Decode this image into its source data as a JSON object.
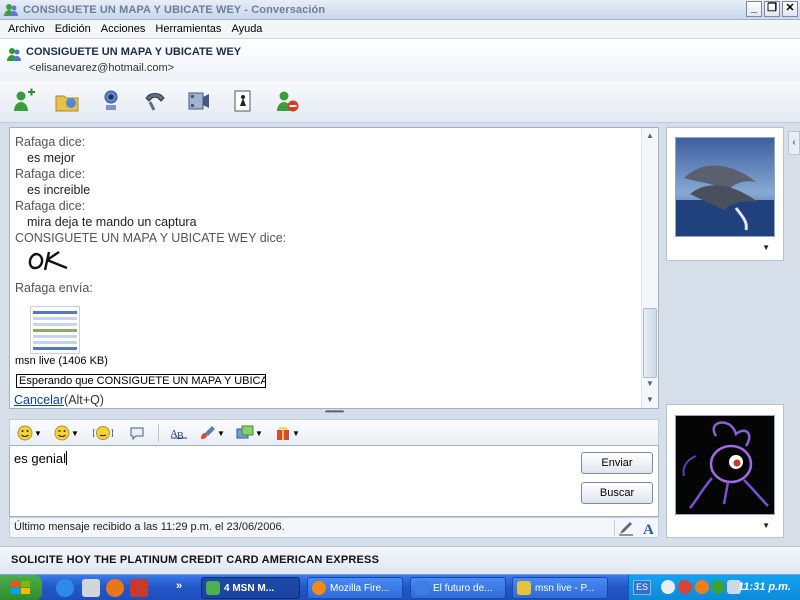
{
  "window": {
    "title": "CONSIGUETE UN MAPA Y UBICATE WEY - Conversación",
    "controls": [
      "_",
      "❐",
      "✕"
    ]
  },
  "menu": [
    "Archivo",
    "Edición",
    "Acciones",
    "Herramientas",
    "Ayuda"
  ],
  "contact": {
    "name": "CONSIGUETE UN MAPA Y UBICATE WEY",
    "email": "<elisanevarez@hotmail.com>"
  },
  "toolbar": {
    "icons": [
      "invite-contact-icon",
      "send-files-icon",
      "webcam-icon",
      "call-icon",
      "video-icon",
      "games-icon",
      "block-icon"
    ]
  },
  "chat": {
    "messages": [
      {
        "sender": "Rafaga dice:",
        "text": "es mejor"
      },
      {
        "sender": "Rafaga dice:",
        "text": "es increible"
      },
      {
        "sender": "Rafaga dice:",
        "text": "mira deja te mando un captura"
      }
    ],
    "contact_sender": "CONSIGUETE UN MAPA Y UBICATE WEY dice:",
    "contact_msg": "OK",
    "transfer_header": "Rafaga envía:",
    "file_label": "msn live (1406 KB)",
    "waiting": "Esperando que CONSIGUETE UN MAPA Y UBICAT...",
    "cancel_link": "Cancelar",
    "cancel_shortcut": "(Alt+Q)"
  },
  "input": {
    "value": "es genial",
    "send_label": "Enviar",
    "search_label": "Buscar"
  },
  "status": {
    "last_message": "Último mensaje recibido a las 11:29 p.m. el 23/06/2006."
  },
  "ad": {
    "text": "SOLICITE HOY THE PLATINUM CREDIT CARD AMERICAN EXPRESS"
  },
  "taskbar": {
    "quicklaunch_more": "»",
    "tasks": [
      {
        "label": "4 MSN M...",
        "active": true,
        "color": "#4caf50"
      },
      {
        "label": "Mozilla Fire...",
        "active": false,
        "color": "#f28a1a"
      },
      {
        "label": "El futuro de...",
        "active": false,
        "color": "#3f7de0"
      },
      {
        "label": "msn live - P...",
        "active": false,
        "color": "#e7c23a"
      }
    ],
    "language": "ES",
    "clock": "11:31 p.m."
  },
  "colors": {
    "accent": "#2458c8",
    "link": "#0b3ea8",
    "tray": "#0b8ad8"
  }
}
